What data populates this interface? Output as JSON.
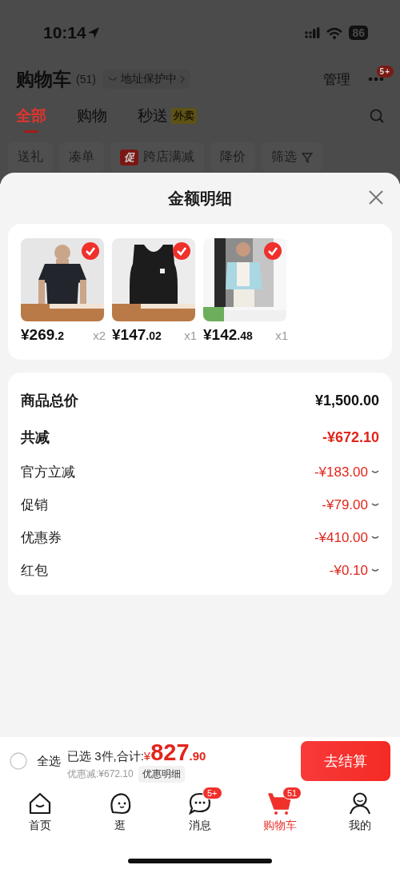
{
  "status_bar": {
    "time": "10:14",
    "battery": "86"
  },
  "header": {
    "title": "购物车",
    "count": "(51)",
    "address_chip": "地址保护中",
    "manage": "管理",
    "more_badge": "5+"
  },
  "tabs": [
    {
      "label": "全部",
      "selected": true
    },
    {
      "label": "购物",
      "selected": false
    },
    {
      "label": "秒送",
      "selected": false,
      "badge": "外卖"
    }
  ],
  "filters": [
    {
      "label": "送礼"
    },
    {
      "label": "凑单"
    },
    {
      "label": "跨店满减",
      "badge": "促"
    },
    {
      "label": "降价"
    },
    {
      "label": "筛选",
      "kind": "filter"
    }
  ],
  "sheet": {
    "title": "金额明细",
    "products": [
      {
        "price": "¥269",
        "price_decimal": ".2",
        "quantity": "x2",
        "checked": true
      },
      {
        "price": "¥147",
        "price_decimal": ".02",
        "quantity": "x1",
        "checked": true
      },
      {
        "price": "¥142",
        "price_decimal": ".48",
        "quantity": "x1",
        "checked": true
      }
    ],
    "summary": [
      {
        "label": "商品总价",
        "value": "¥1,500.00",
        "kind": "total"
      },
      {
        "label": "共减",
        "value": "-¥672.10",
        "kind": "discount_total"
      },
      {
        "label": "官方立减",
        "value": "-¥183.00",
        "kind": "detail"
      },
      {
        "label": "促销",
        "value": "-¥79.00",
        "kind": "detail"
      },
      {
        "label": "优惠券",
        "value": "-¥410.00",
        "kind": "detail"
      },
      {
        "label": "红包",
        "value": "-¥0.10",
        "kind": "detail"
      }
    ]
  },
  "checkout": {
    "select_all": {
      "label": "全选",
      "checked": false
    },
    "selected_text": "已选 3件,合计:",
    "currency": "¥",
    "total": "827",
    "total_decimal": ".90",
    "saving": "优惠减:¥672.10",
    "details_button": "优惠明细",
    "pay_button": "去结算"
  },
  "nav": [
    {
      "label": "首页",
      "selected": false
    },
    {
      "label": "逛",
      "selected": false
    },
    {
      "label": "消息",
      "selected": false,
      "badge": "5+"
    },
    {
      "label": "购物车",
      "selected": true,
      "badge": "51"
    },
    {
      "label": "我的",
      "selected": false
    }
  ]
}
